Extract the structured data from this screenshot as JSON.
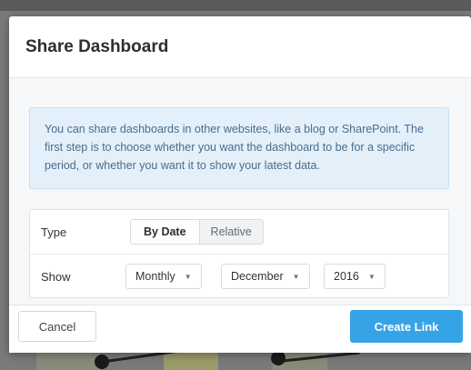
{
  "dialog": {
    "title": "Share Dashboard",
    "info_text": "You can share dashboards in other websites, like a blog or SharePoint. The first step is to choose whether you want the dashboard to be for a specific period, or whether you want it to show your latest data."
  },
  "form": {
    "type": {
      "label": "Type",
      "options": [
        "By Date",
        "Relative"
      ],
      "selected": "By Date"
    },
    "show": {
      "label": "Show",
      "period": "Monthly",
      "month": "December",
      "year": "2016"
    }
  },
  "footer": {
    "cancel_label": "Cancel",
    "create_label": "Create Link"
  },
  "colors": {
    "primary": "#36a3e6",
    "info_background": "#e3f0fa",
    "info_text": "#4a6d8c"
  }
}
